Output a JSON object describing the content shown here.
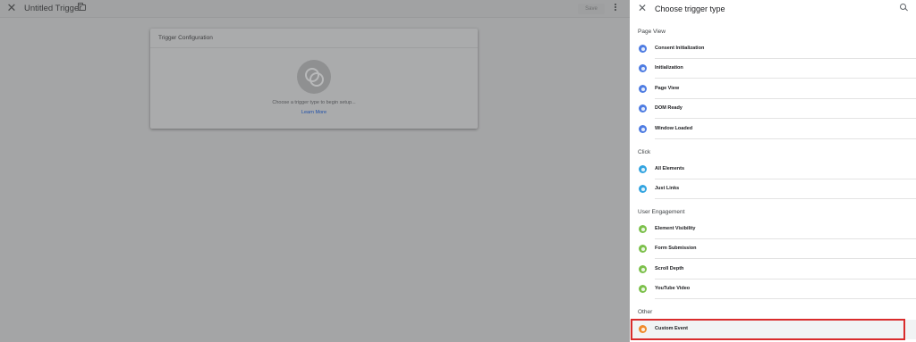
{
  "editor": {
    "title": "Untitled Trigger",
    "save_label": "Save",
    "card": {
      "title": "Trigger Configuration",
      "hint": "Choose a trigger type to begin setup...",
      "link": "Learn More"
    }
  },
  "panel": {
    "title": "Choose trigger type",
    "sections": [
      {
        "label": "Page View",
        "items": [
          {
            "label": "Consent Initialization",
            "icon": "shield-icon",
            "color": "#4e7ce2"
          },
          {
            "label": "Initialization",
            "icon": "power-icon",
            "color": "#4e7ce2"
          },
          {
            "label": "Page View",
            "icon": "eye-icon",
            "color": "#4e7ce2"
          },
          {
            "label": "DOM Ready",
            "icon": "document-icon",
            "color": "#4e7ce2"
          },
          {
            "label": "Window Loaded",
            "icon": "window-icon",
            "color": "#4e7ce2"
          }
        ]
      },
      {
        "label": "Click",
        "items": [
          {
            "label": "All Elements",
            "icon": "cursor-icon",
            "color": "#33a4e0"
          },
          {
            "label": "Just Links",
            "icon": "link-icon",
            "color": "#33a4e0"
          }
        ]
      },
      {
        "label": "User Engagement",
        "items": [
          {
            "label": "Element Visibility",
            "icon": "visibility-icon",
            "color": "#7cc04b"
          },
          {
            "label": "Form Submission",
            "icon": "form-icon",
            "color": "#7cc04b"
          },
          {
            "label": "Scroll Depth",
            "icon": "scroll-icon",
            "color": "#7cc04b"
          },
          {
            "label": "YouTube Video",
            "icon": "play-icon",
            "color": "#7cc04b"
          }
        ]
      },
      {
        "label": "Other",
        "items": [
          {
            "label": "Custom Event",
            "icon": "code-icon",
            "color": "#ef8b2c",
            "selected": true
          }
        ]
      }
    ]
  }
}
